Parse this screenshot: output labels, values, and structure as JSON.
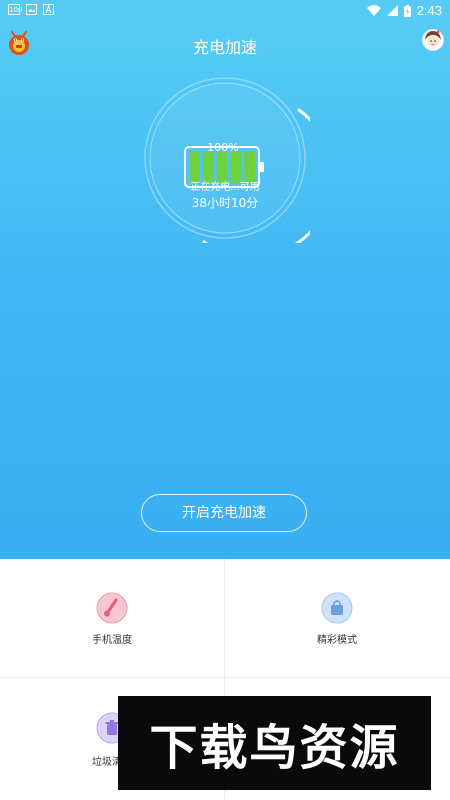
{
  "status_bar": {
    "notif_icons": [
      "news-icon",
      "image-icon",
      "a-icon"
    ],
    "badge_text": "100",
    "time": "2:43"
  },
  "header": {
    "title": "充电加速"
  },
  "battery": {
    "percent": "100%",
    "charge_level": 1.0,
    "status": "正在充电...可用",
    "remaining": "38小时10分"
  },
  "actions": {
    "boost_label": "开启充电加速"
  },
  "features": [
    {
      "label": "手机温度",
      "icon": "thermometer-icon",
      "color": "#f4a7b9"
    },
    {
      "label": "精彩模式",
      "icon": "shopping-bag-icon",
      "color": "#9fc6f2"
    },
    {
      "label": "垃圾清理",
      "icon": "trash-icon",
      "color": "#b9a9f0"
    },
    {
      "label": "",
      "icon": "",
      "color": ""
    }
  ],
  "watermark": {
    "text": "下载鸟资源"
  },
  "colors": {
    "hero_top": "#55cbf5",
    "hero_bottom": "#3aaef2",
    "battery_green": "#6fd241"
  }
}
